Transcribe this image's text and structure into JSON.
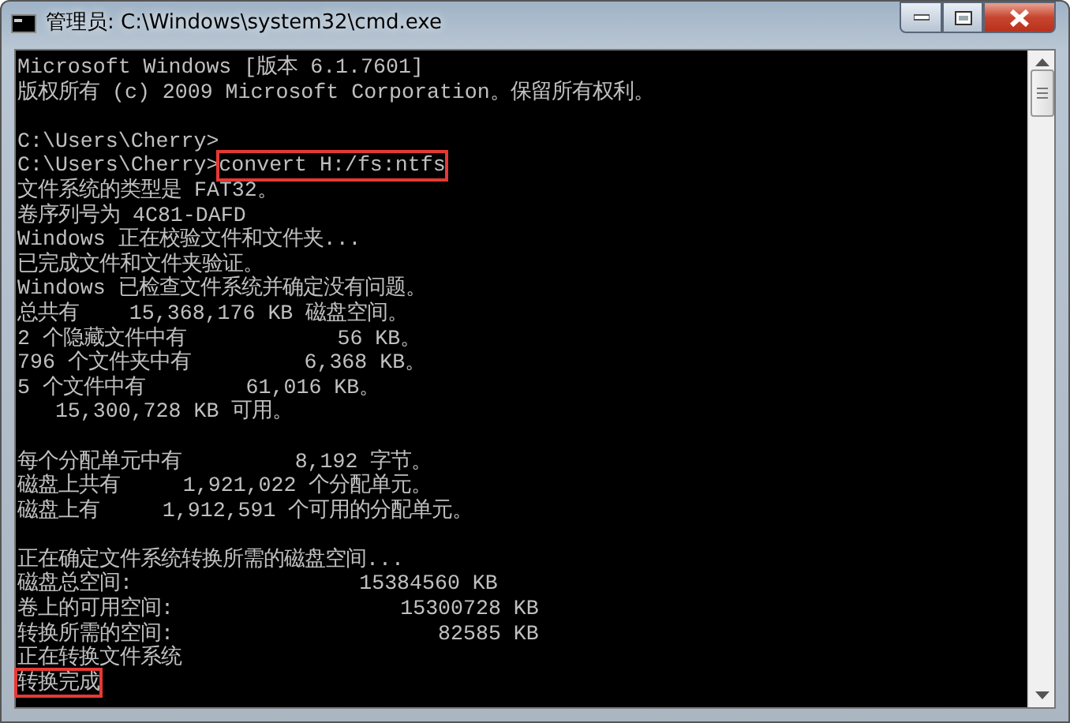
{
  "window": {
    "title": "管理员: C:\\Windows\\system32\\cmd.exe"
  },
  "console": {
    "lines": [
      {
        "kind": "text",
        "parts": [
          {
            "text": "Microsoft Windows [版本 6.1.7601]",
            "highlighted": false
          }
        ]
      },
      {
        "kind": "text",
        "parts": [
          {
            "text": "版权所有 (c) 2009 Microsoft Corporation。保留所有权利。",
            "highlighted": false
          }
        ]
      },
      {
        "kind": "blank"
      },
      {
        "kind": "text",
        "parts": [
          {
            "text": "C:\\Users\\Cherry>",
            "highlighted": false
          }
        ]
      },
      {
        "kind": "text",
        "parts": [
          {
            "text": "C:\\Users\\Cherry>",
            "highlighted": false
          },
          {
            "text": "convert H:/fs:ntfs",
            "highlighted": true
          }
        ]
      },
      {
        "kind": "text",
        "parts": [
          {
            "text": "文件系统的类型是 FAT32。",
            "highlighted": false
          }
        ]
      },
      {
        "kind": "text",
        "parts": [
          {
            "text": "卷序列号为 4C81-DAFD",
            "highlighted": false
          }
        ]
      },
      {
        "kind": "text",
        "parts": [
          {
            "text": "Windows 正在校验文件和文件夹...",
            "highlighted": false
          }
        ]
      },
      {
        "kind": "text",
        "parts": [
          {
            "text": "已完成文件和文件夹验证。",
            "highlighted": false
          }
        ]
      },
      {
        "kind": "text",
        "parts": [
          {
            "text": "Windows 已检查文件系统并确定没有问题。",
            "highlighted": false
          }
        ]
      },
      {
        "kind": "text",
        "parts": [
          {
            "text": "总共有    15,368,176 KB 磁盘空间。",
            "highlighted": false
          }
        ]
      },
      {
        "kind": "text",
        "parts": [
          {
            "text": "2 个隐藏文件中有            56 KB。",
            "highlighted": false
          }
        ]
      },
      {
        "kind": "text",
        "parts": [
          {
            "text": "796 个文件夹中有         6,368 KB。",
            "highlighted": false
          }
        ]
      },
      {
        "kind": "text",
        "parts": [
          {
            "text": "5 个文件中有        61,016 KB。",
            "highlighted": false
          }
        ]
      },
      {
        "kind": "text",
        "parts": [
          {
            "text": "   15,300,728 KB 可用。",
            "highlighted": false
          }
        ]
      },
      {
        "kind": "blank"
      },
      {
        "kind": "text",
        "parts": [
          {
            "text": "每个分配单元中有         8,192 字节。",
            "highlighted": false
          }
        ]
      },
      {
        "kind": "text",
        "parts": [
          {
            "text": "磁盘上共有     1,921,022 个分配单元。",
            "highlighted": false
          }
        ]
      },
      {
        "kind": "text",
        "parts": [
          {
            "text": "磁盘上有     1,912,591 个可用的分配单元。",
            "highlighted": false
          }
        ]
      },
      {
        "kind": "blank"
      },
      {
        "kind": "text",
        "parts": [
          {
            "text": "正在确定文件系统转换所需的磁盘空间...",
            "highlighted": false
          }
        ]
      },
      {
        "kind": "text",
        "parts": [
          {
            "text": "磁盘总空间:                  15384560 KB",
            "highlighted": false
          }
        ]
      },
      {
        "kind": "text",
        "parts": [
          {
            "text": "卷上的可用空间:                  15300728 KB",
            "highlighted": false
          }
        ]
      },
      {
        "kind": "text",
        "parts": [
          {
            "text": "转换所需的空间:                     82585 KB",
            "highlighted": false
          }
        ]
      },
      {
        "kind": "text",
        "parts": [
          {
            "text": "正在转换文件系统",
            "highlighted": false
          }
        ]
      },
      {
        "kind": "text",
        "parts": [
          {
            "text": "转换完成",
            "highlighted": true
          }
        ]
      }
    ]
  }
}
